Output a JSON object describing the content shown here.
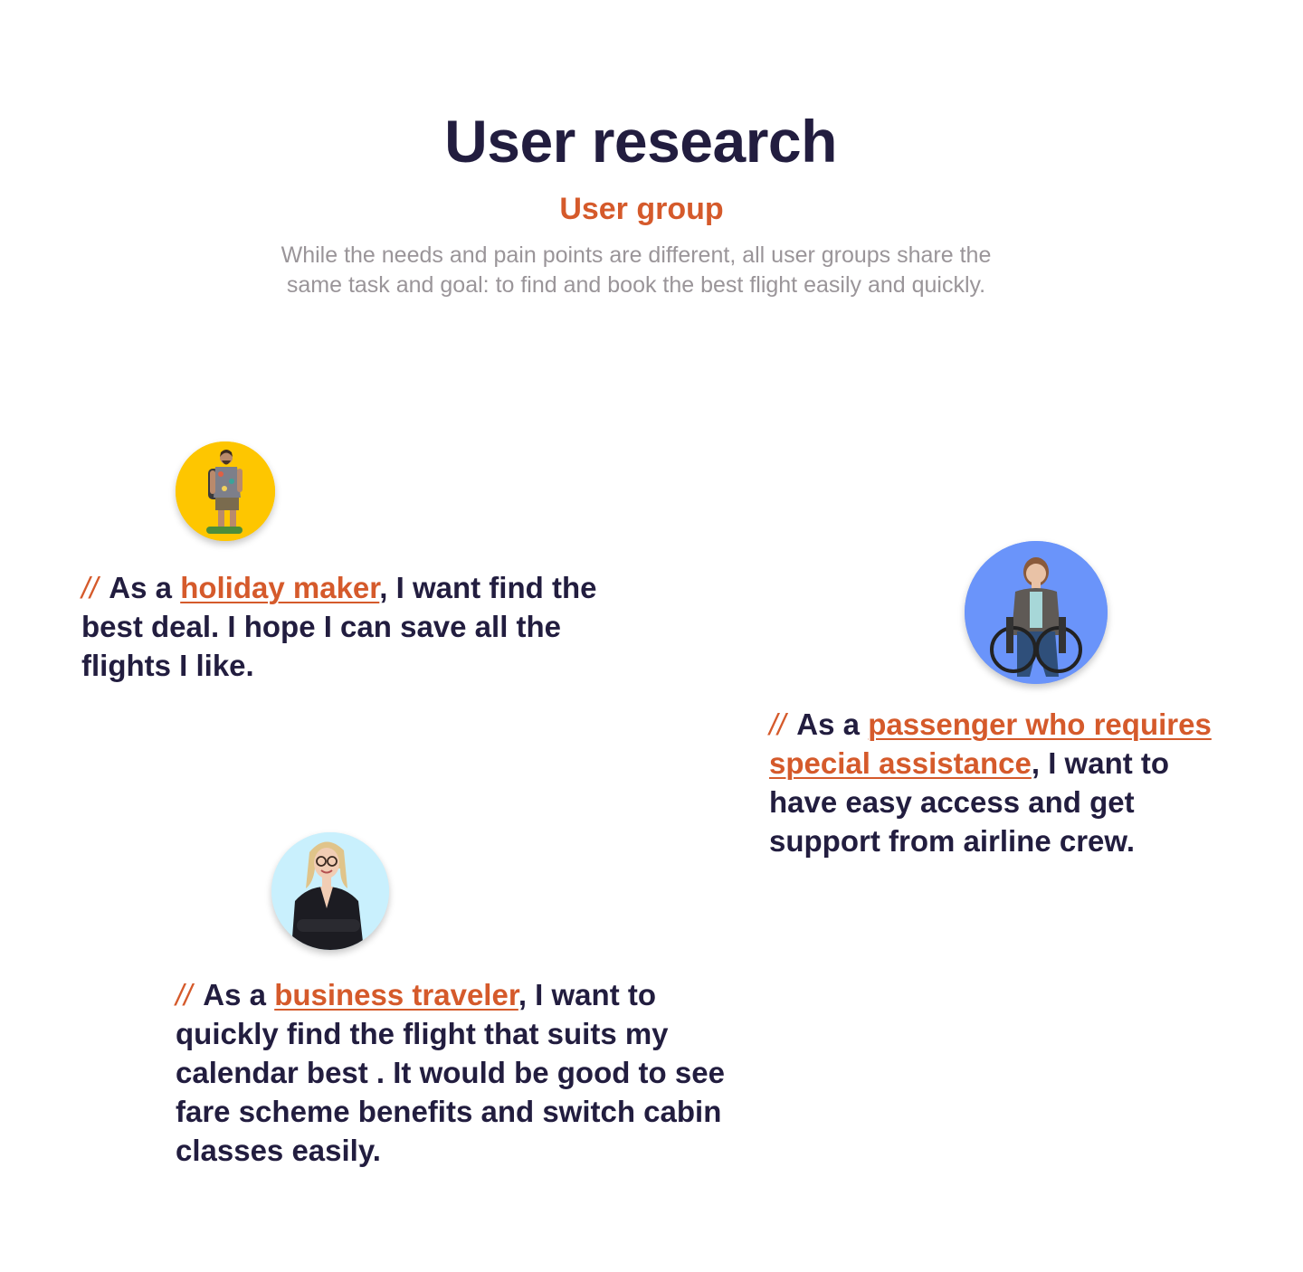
{
  "header": {
    "title": "User research",
    "subtitle": "User group",
    "description": "While the needs and pain points are different, all user groups share the same task and goal: to find and book the best flight easily and quickly."
  },
  "personas": [
    {
      "prefix": "//",
      "lead": "As a",
      "role": "holiday maker",
      "rest": ", I want find the best deal. I hope I can save all the flights I like.",
      "avatar_bg": "#fec600",
      "avatar_icon": "holiday-maker-avatar"
    },
    {
      "prefix": "//",
      "lead": "As a",
      "role": "passenger who requires special assistance",
      "rest": ", I want to have easy access and get support from airline crew.",
      "avatar_bg": "#6a94fa",
      "avatar_icon": "wheelchair-passenger-avatar"
    },
    {
      "prefix": "//",
      "lead": "As a",
      "role": "business traveler",
      "rest": ", I want to quickly find the flight that suits my calendar best . It would be good to see fare scheme benefits and switch cabin classes easily.",
      "avatar_bg": "#c9f0fd",
      "avatar_icon": "business-traveler-avatar"
    }
  ],
  "colors": {
    "accent": "#d55a2b",
    "heading": "#221d3f",
    "muted": "#9a9599"
  }
}
